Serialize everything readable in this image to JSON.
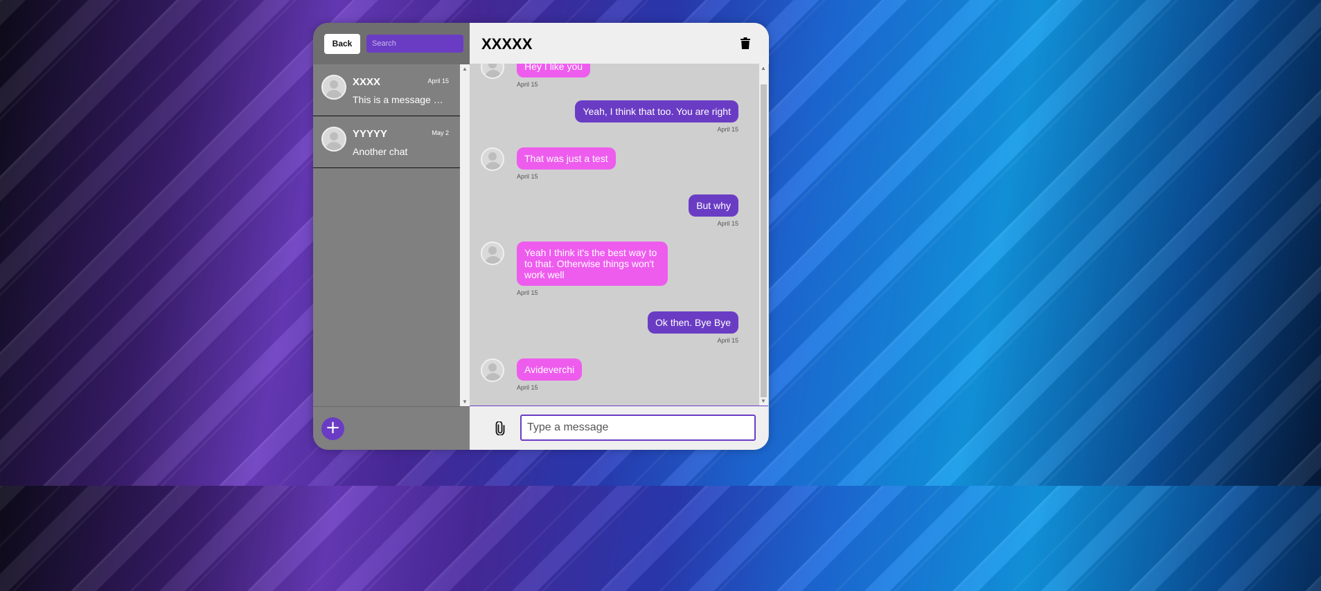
{
  "sidebar": {
    "back_label": "Back",
    "search_placeholder": "Search",
    "chats": [
      {
        "name": "XXXX",
        "date": "April 15",
        "preview": "This is a message sample"
      },
      {
        "name": "YYYYY",
        "date": "May 2",
        "preview": "Another chat"
      }
    ],
    "add_label": "+"
  },
  "conversation": {
    "title": "XXXXX",
    "messages": [
      {
        "direction": "in",
        "text": "Hey I like you",
        "date": "April 15"
      },
      {
        "direction": "out",
        "text": "Yeah, I think that too. You are right",
        "date": "April 15"
      },
      {
        "direction": "in",
        "text": "That was just a test",
        "date": "April 15"
      },
      {
        "direction": "out",
        "text": "But why",
        "date": "April 15"
      },
      {
        "direction": "in",
        "text": "Yeah I think it's the best way to to that. Otherwise things won't work well",
        "date": "April 15"
      },
      {
        "direction": "out",
        "text": "Ok then. Bye Bye",
        "date": "April 15"
      },
      {
        "direction": "in",
        "text": "Avideverchi",
        "date": "April 15"
      }
    ],
    "input_placeholder": "Type a message"
  },
  "icons": {
    "delete": "trash-icon",
    "attach": "paperclip-icon",
    "avatar": "user-avatar-icon",
    "add": "plus-icon"
  },
  "colors": {
    "accent": "#6a3cc4",
    "incoming_bubble": "#ee5cee",
    "outgoing_bubble": "#6a3cc4"
  }
}
